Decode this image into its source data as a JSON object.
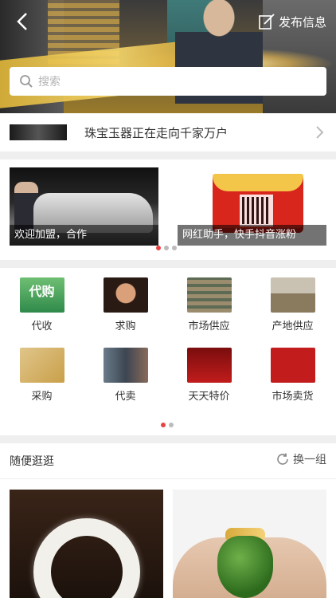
{
  "header": {
    "publish_label": "发布信息",
    "search_placeholder": "搜索"
  },
  "notice": {
    "text": "珠宝玉器正在走向千家万户"
  },
  "carousel": {
    "slides": [
      {
        "caption": "欢迎加盟，合作"
      },
      {
        "caption": "网红助手，快手抖音涨粉"
      }
    ],
    "active_index": 0,
    "dot_count": 3
  },
  "menu": {
    "items": [
      {
        "label": "代收",
        "icon_text": "代购"
      },
      {
        "label": "求购"
      },
      {
        "label": "市场供应"
      },
      {
        "label": "产地供应"
      },
      {
        "label": "采购"
      },
      {
        "label": "代卖"
      },
      {
        "label": "天天特价"
      },
      {
        "label": "市场卖货"
      }
    ],
    "page_count": 2,
    "active_page": 0
  },
  "browse": {
    "title": "随便逛逛",
    "refresh_label": "换一组"
  },
  "colors": {
    "accent": "#e84343",
    "background": "#efefef"
  }
}
